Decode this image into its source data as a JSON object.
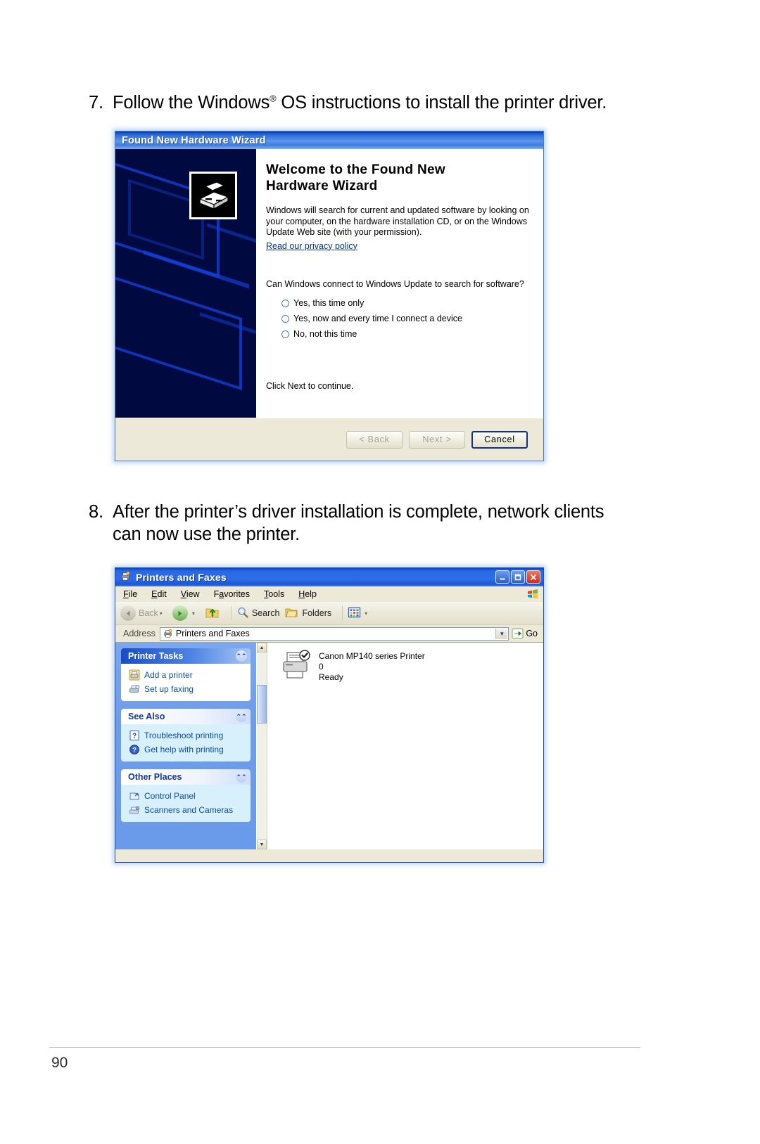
{
  "page": {
    "number": "90"
  },
  "steps": [
    {
      "number": "7.",
      "text_before": "Follow the Windows",
      "superscript": "®",
      "text_after": " OS instructions to install the printer driver."
    },
    {
      "number": "8.",
      "text": "After the printer’s driver installation is complete, network clients can now use the printer."
    }
  ],
  "wizard": {
    "title": "Found New Hardware Wizard",
    "heading_line1": "Welcome to the Found New",
    "heading_line2": "Hardware Wizard",
    "paragraph1": "Windows will search for current and updated software by looking on your computer, on the hardware installation CD, or on the Windows Update Web site (with your permission).",
    "privacy_link": "Read our privacy policy",
    "question": "Can Windows connect to Windows Update to search for software?",
    "options": [
      {
        "label": "Yes, this time only",
        "selected": false
      },
      {
        "label": "Yes, now and every time I connect a device",
        "selected": false
      },
      {
        "label": "No, not this time",
        "selected": false
      }
    ],
    "click_next": "Click Next to continue.",
    "buttons": [
      {
        "label": "< Back",
        "state": "disabled"
      },
      {
        "label": "Next >",
        "state": "disabled"
      },
      {
        "label": "Cancel",
        "state": "default"
      }
    ]
  },
  "explorer": {
    "title": "Printers and Faxes",
    "window_buttons": [
      {
        "name": "minimize",
        "glyph": "_"
      },
      {
        "name": "maximize",
        "glyph": "❐"
      },
      {
        "name": "close",
        "glyph": "✕"
      }
    ],
    "menu": [
      "File",
      "Edit",
      "View",
      "Favorites",
      "Tools",
      "Help"
    ],
    "toolbar": {
      "back": "Back",
      "search": "Search",
      "folders": "Folders"
    },
    "address": {
      "label": "Address",
      "value": "Printers and Faxes",
      "go": "Go"
    },
    "task_panels": [
      {
        "title": "Printer Tasks",
        "style": "blue",
        "items": [
          {
            "label": "Add a printer",
            "icon": "add-printer-icon"
          },
          {
            "label": "Set up faxing",
            "icon": "fax-icon"
          }
        ]
      },
      {
        "title": "See Also",
        "style": "light",
        "items": [
          {
            "label": "Troubleshoot printing",
            "icon": "help-question-icon"
          },
          {
            "label": "Get help with printing",
            "icon": "help-circle-icon"
          }
        ]
      },
      {
        "title": "Other Places",
        "style": "light",
        "items": [
          {
            "label": "Control Panel",
            "icon": "control-panel-icon"
          },
          {
            "label": "Scanners and Cameras",
            "icon": "scanner-icon"
          }
        ]
      }
    ],
    "printer": {
      "name": "Canon MP140 series Printer",
      "queue": "0",
      "status": "Ready"
    }
  }
}
